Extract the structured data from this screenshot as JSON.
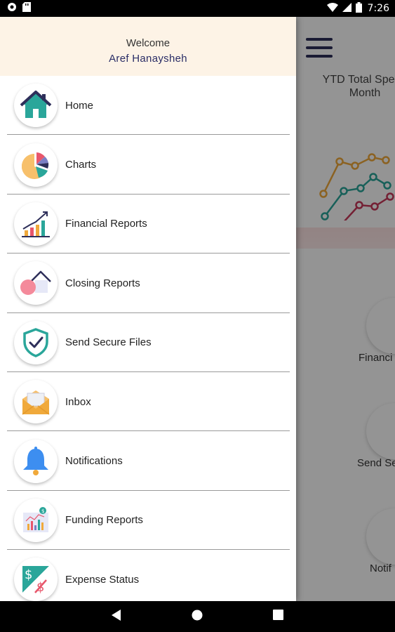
{
  "status_bar": {
    "time": "7:26"
  },
  "drawer": {
    "welcome": "Welcome",
    "user_name": "Aref Hanaysheh",
    "items": [
      {
        "label": "Home",
        "icon": "home-icon"
      },
      {
        "label": "Charts",
        "icon": "pie-chart-icon"
      },
      {
        "label": "Financial Reports",
        "icon": "bar-chart-icon"
      },
      {
        "label": "Closing Reports",
        "icon": "closing-house-icon"
      },
      {
        "label": "Send Secure Files",
        "icon": "shield-check-icon"
      },
      {
        "label": "Inbox",
        "icon": "envelope-icon"
      },
      {
        "label": "Notifications",
        "icon": "bell-icon"
      },
      {
        "label": "Funding Reports",
        "icon": "funding-chart-icon"
      },
      {
        "label": "Expense Status",
        "icon": "dollar-icon"
      }
    ]
  },
  "background": {
    "chart_title": "YTD Total Spend\nMonth",
    "tiles": [
      "Financi",
      "Send Se",
      "Notif"
    ]
  },
  "colors": {
    "header_bg": "#fdf3e6",
    "accent": "#2a2d66",
    "teal": "#2aa69a",
    "orange": "#f0a93b"
  }
}
